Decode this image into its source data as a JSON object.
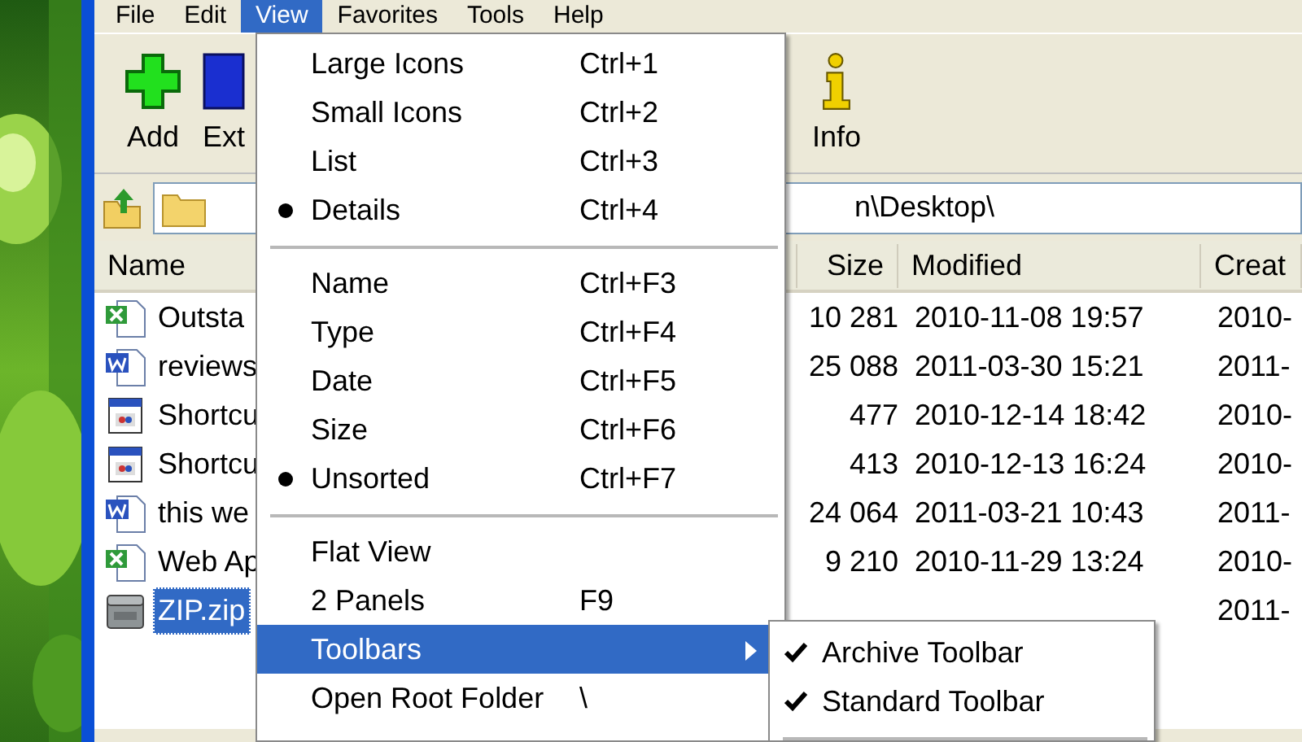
{
  "menubar": [
    {
      "label": "File",
      "selected": false
    },
    {
      "label": "Edit",
      "selected": false
    },
    {
      "label": "View",
      "selected": true
    },
    {
      "label": "Favorites",
      "selected": false
    },
    {
      "label": "Tools",
      "selected": false
    },
    {
      "label": "Help",
      "selected": false
    }
  ],
  "toolbar": [
    {
      "label": "Add",
      "kind": "add"
    },
    {
      "label": "Ext",
      "kind": "extract"
    },
    {
      "label": "Info",
      "kind": "info"
    }
  ],
  "address": {
    "value": "n\\Desktop\\"
  },
  "columns": [
    "Name",
    "Size",
    "Modified",
    "Creat"
  ],
  "rows": [
    {
      "kind": "excel",
      "name": "Outsta",
      "size": "10 281",
      "modified": "2010-11-08 19:57",
      "created": "2010-",
      "selected": false
    },
    {
      "kind": "word",
      "name": "reviews",
      "size": "25 088",
      "modified": "2011-03-30 15:21",
      "created": "2011-",
      "selected": false
    },
    {
      "kind": "shortcut",
      "name": "Shortcu",
      "size": "477",
      "modified": "2010-12-14 18:42",
      "created": "2010-",
      "selected": false
    },
    {
      "kind": "shortcut",
      "name": "Shortcu",
      "size": "413",
      "modified": "2010-12-13 16:24",
      "created": "2010-",
      "selected": false
    },
    {
      "kind": "word",
      "name": "this we",
      "size": "24 064",
      "modified": "2011-03-21 10:43",
      "created": "2011-",
      "selected": false
    },
    {
      "kind": "excel",
      "name": "Web Ap",
      "size": "9 210",
      "modified": "2010-11-29 13:24",
      "created": "2010-",
      "selected": false
    },
    {
      "kind": "zip",
      "name": "ZIP.zip",
      "created": "2011-",
      "selected": true
    }
  ],
  "view_menu": [
    {
      "kind": "item",
      "label": "Large Icons",
      "shortcut": "Ctrl+1",
      "checked": false,
      "selected": false
    },
    {
      "kind": "item",
      "label": "Small Icons",
      "shortcut": "Ctrl+2",
      "checked": false,
      "selected": false
    },
    {
      "kind": "item",
      "label": "List",
      "shortcut": "Ctrl+3",
      "checked": false,
      "selected": false
    },
    {
      "kind": "item",
      "label": "Details",
      "shortcut": "Ctrl+4",
      "checked": true,
      "selected": false
    },
    {
      "kind": "separator"
    },
    {
      "kind": "item",
      "label": "Name",
      "shortcut": "Ctrl+F3",
      "checked": false,
      "selected": false
    },
    {
      "kind": "item",
      "label": "Type",
      "shortcut": "Ctrl+F4",
      "checked": false,
      "selected": false
    },
    {
      "kind": "item",
      "label": "Date",
      "shortcut": "Ctrl+F5",
      "checked": false,
      "selected": false
    },
    {
      "kind": "item",
      "label": "Size",
      "shortcut": "Ctrl+F6",
      "checked": false,
      "selected": false
    },
    {
      "kind": "item",
      "label": "Unsorted",
      "shortcut": "Ctrl+F7",
      "checked": true,
      "selected": false
    },
    {
      "kind": "separator"
    },
    {
      "kind": "item",
      "label": "Flat View",
      "checked": false,
      "selected": false
    },
    {
      "kind": "item",
      "label": "2 Panels",
      "shortcut": "F9",
      "checked": false,
      "selected": false
    },
    {
      "kind": "item",
      "label": "Toolbars",
      "checked": false,
      "selected": true,
      "submenu": [
        {
          "label": "Archive Toolbar",
          "checked": true
        },
        {
          "label": "Standard Toolbar",
          "checked": true
        }
      ]
    },
    {
      "kind": "item",
      "label": "Open Root Folder",
      "shortcut": "\\",
      "checked": false,
      "selected": false
    }
  ]
}
